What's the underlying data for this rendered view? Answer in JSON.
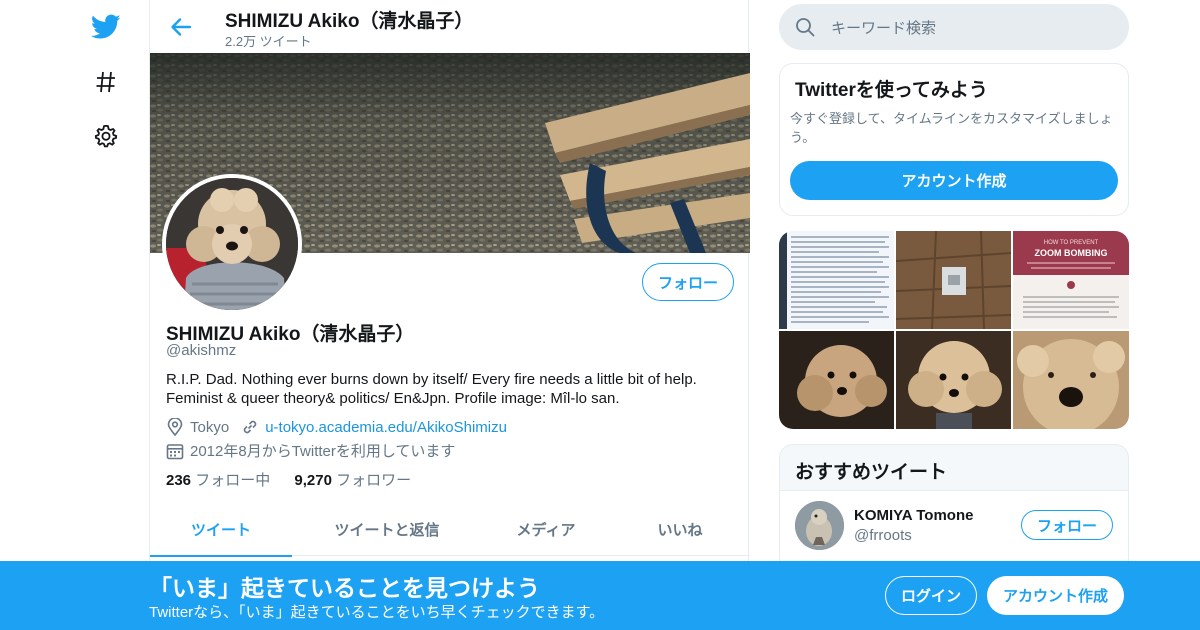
{
  "colors": {
    "accent": "#1da1f2",
    "text": "#14171a",
    "muted": "#657786",
    "border": "#e6ecf0"
  },
  "nav": {
    "icons": [
      "twitter-bird-icon",
      "hashtag-icon",
      "gear-icon"
    ]
  },
  "header": {
    "title": "SHIMIZU Akiko（清水晶子）",
    "tweet_count": "2.2万 ツイート"
  },
  "profile": {
    "follow_label": "フォロー",
    "name": "SHIMIZU Akiko（清水晶子）",
    "handle": "@akishmz",
    "bio_line1": "R.I.P. Dad. Nothing ever burns down by itself/ Every fire needs a little bit of help.",
    "bio_line2": "Feminist & queer theory& politics/ En&Jpn. Profile image: Mîl-lo san.",
    "location": "Tokyo",
    "url": "u-tokyo.academia.edu/AkikoShimizu",
    "joined": "2012年8月からTwitterを利用しています",
    "following_count": "236",
    "following_label": "フォロー中",
    "followers_count": "9,270",
    "followers_label": "フォロワー"
  },
  "tabs": [
    {
      "label": "ツイート"
    },
    {
      "label": "ツイートと返信"
    },
    {
      "label": "メディア"
    },
    {
      "label": "いいね"
    }
  ],
  "search": {
    "placeholder": "キーワード検索"
  },
  "signup_card": {
    "title": "Twitterを使ってみよう",
    "description": "今すぐ登録して、タイムラインをカスタマイズしましょう。",
    "button": "アカウント作成"
  },
  "media_thumbs": {
    "zoom_heading_small": "HOW TO PREVENT",
    "zoom_heading": "ZOOM BOMBING"
  },
  "recommended": {
    "title": "おすすめツイート",
    "items": [
      {
        "name": "KOMIYA Tomone",
        "handle": "@frroots",
        "follow_label": "フォロー"
      }
    ]
  },
  "bottom_bar": {
    "title": "「いま」起きていることを見つけよう",
    "subtitle": "Twitterなら、「いま」起きていることをいち早くチェックできます。",
    "login_label": "ログイン",
    "signup_label": "アカウント作成"
  }
}
